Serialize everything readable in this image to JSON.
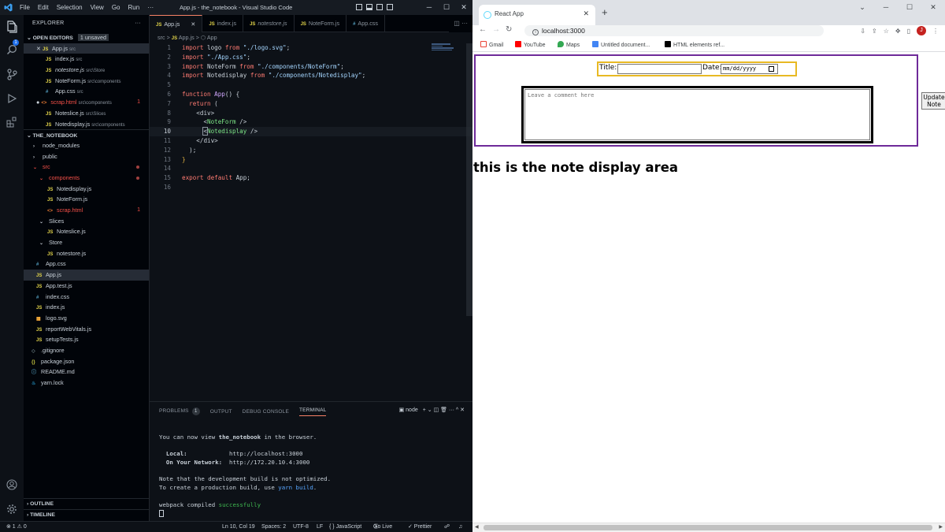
{
  "vscode": {
    "window_title": "App.js - the_notebook - Visual Studio Code",
    "menu": [
      "File",
      "Edit",
      "Selection",
      "View",
      "Go",
      "Run",
      "···"
    ],
    "activity_badge": "1",
    "explorer_title": "EXPLORER",
    "explorer_more": "···",
    "open_editors": {
      "title": "OPEN EDITORS",
      "badge": "1 unsaved",
      "items": [
        {
          "icon": "JS",
          "name": "App.js",
          "path": "src"
        },
        {
          "icon": "JS",
          "name": "index.js",
          "path": "src"
        },
        {
          "icon": "JS",
          "name": "notestore.js",
          "path": "src\\Store"
        },
        {
          "icon": "JS",
          "name": "NoteForm.js",
          "path": "src\\components"
        },
        {
          "icon": "#",
          "name": "App.css",
          "path": "src"
        },
        {
          "icon": "<>",
          "name": "scrap.html",
          "path": "src\\components",
          "count": "1"
        },
        {
          "icon": "JS",
          "name": "Noteslice.js",
          "path": "src\\Slices"
        },
        {
          "icon": "JS",
          "name": "Notedisplay.js",
          "path": "src\\components"
        }
      ]
    },
    "project": {
      "title": "THE_NOTEBOOK",
      "items": [
        {
          "icon": "›",
          "name": "node_modules"
        },
        {
          "icon": "›",
          "name": "public"
        },
        {
          "icon": "⌄",
          "name": "src"
        },
        {
          "icon": "⌄",
          "name": "components"
        },
        {
          "icon": "JS",
          "name": "Notedisplay.js"
        },
        {
          "icon": "JS",
          "name": "NoteForm.js"
        },
        {
          "icon": "<>",
          "name": "scrap.html",
          "count": "1"
        },
        {
          "icon": "⌄",
          "name": "Slices"
        },
        {
          "icon": "JS",
          "name": "Noteslice.js"
        },
        {
          "icon": "⌄",
          "name": "Store"
        },
        {
          "icon": "JS",
          "name": "notestore.js"
        },
        {
          "icon": "#",
          "name": "App.css"
        },
        {
          "icon": "JS",
          "name": "App.js"
        },
        {
          "icon": "JS",
          "name": "App.test.js"
        },
        {
          "icon": "#",
          "name": "index.css"
        },
        {
          "icon": "JS",
          "name": "index.js"
        },
        {
          "icon": "",
          "name": "logo.svg"
        },
        {
          "icon": "JS",
          "name": "reportWebVitals.js"
        },
        {
          "icon": "JS",
          "name": "setupTests.js"
        },
        {
          "icon": "◇",
          "name": ".gitignore"
        },
        {
          "icon": "{}",
          "name": "package.json"
        },
        {
          "icon": "ⓘ",
          "name": "README.md"
        },
        {
          "icon": "",
          "name": "yarn.lock"
        }
      ]
    },
    "outline": "OUTLINE",
    "timeline": "TIMELINE",
    "tabs": [
      {
        "icon": "JS",
        "label": "App.js",
        "close": "✕"
      },
      {
        "icon": "JS",
        "label": "index.js"
      },
      {
        "icon": "JS",
        "label": "notestore.js"
      },
      {
        "icon": "JS",
        "label": "NoteForm.js"
      },
      {
        "icon": "#",
        "label": "App.css"
      }
    ],
    "tab_actions": "◫ ···",
    "breadcrumb": {
      "folder": "src",
      "sep": ">",
      "file_icon": "JS",
      "file": "App.js",
      "symbol": "App"
    },
    "code_lines": [
      {
        "n": "1"
      },
      {
        "n": "2"
      },
      {
        "n": "3"
      },
      {
        "n": "4"
      },
      {
        "n": "5"
      },
      {
        "n": "6"
      },
      {
        "n": "7"
      },
      {
        "n": "8"
      },
      {
        "n": "9"
      },
      {
        "n": "10"
      },
      {
        "n": "11"
      },
      {
        "n": "12"
      },
      {
        "n": "13"
      },
      {
        "n": "14"
      },
      {
        "n": "15"
      },
      {
        "n": "16"
      }
    ],
    "code": {
      "import": "import",
      "from": "from",
      "logo": " logo ",
      "logo_path": "\"./logo.svg\"",
      "css_path": "\"./App.css\"",
      "noteform": " NoteForm ",
      "noteform_path": "\"./components/NoteForm\"",
      "notedisplay": " Notedisplay ",
      "notedisplay_path": "\"./components/Notedisplay\"",
      "semi": ";",
      "function": "function",
      "app_name": " App",
      "paren_brace": "() {",
      "return": "return",
      "open_paren": " (",
      "div_open": "<div>",
      "lt": "<",
      "noteform_tag": "NoteForm",
      "notedisplay_tag": "Notedisplay",
      "self_close": " />",
      "div_close": "</div>",
      "paren_semi": ");",
      "brace": "}",
      "export": "export",
      "default": " default",
      "app_semi": " App;"
    },
    "panel": {
      "tabs": [
        "PROBLEMS",
        "OUTPUT",
        "DEBUG CONSOLE",
        "TERMINAL"
      ],
      "problems_count": "1",
      "terminal_name": "node",
      "actions": "+ ⌄  ◫  🗑  ···  ^  ✕"
    },
    "terminal": {
      "line1_pre": "You can now view ",
      "line1_app": "the_notebook",
      "line1_post": " in the browser.",
      "local_label": "Local:",
      "local_url": "http://localhost:3000",
      "network_label": "On Your Network:",
      "network_url": "http://172.20.10.4:3000",
      "note1": "Note that the development build is not optimized.",
      "note2_pre": "To create a production build, use ",
      "note2_cmd": "yarn build",
      "note2_post": ".",
      "compiled_pre": "webpack compiled ",
      "compiled_status": "successfully"
    },
    "status": {
      "errors": "⊗ 1 ⚠ 0",
      "position": "Ln 10, Col 19",
      "spaces": "Spaces: 2",
      "encoding": "UTF-8",
      "eol": "LF",
      "language": "{ } JavaScript",
      "golive": "Go Live",
      "prettier": "✓ Prettier"
    }
  },
  "chrome": {
    "tab_title": "React App",
    "tab_close": "✕",
    "new_tab": "+",
    "url": "localhost:3000",
    "bookmarks": [
      "Gmail",
      "YouTube",
      "Maps",
      "Untitled document...",
      "HTML elements ref..."
    ],
    "avatar": "J",
    "page": {
      "title_label": "Title:",
      "date_label": "Date:",
      "date_placeholder": "mm/dd/yyyy",
      "comment_placeholder": "Leave a comment here",
      "update_button": "Update Note",
      "display_text": "this is the note display area"
    }
  }
}
